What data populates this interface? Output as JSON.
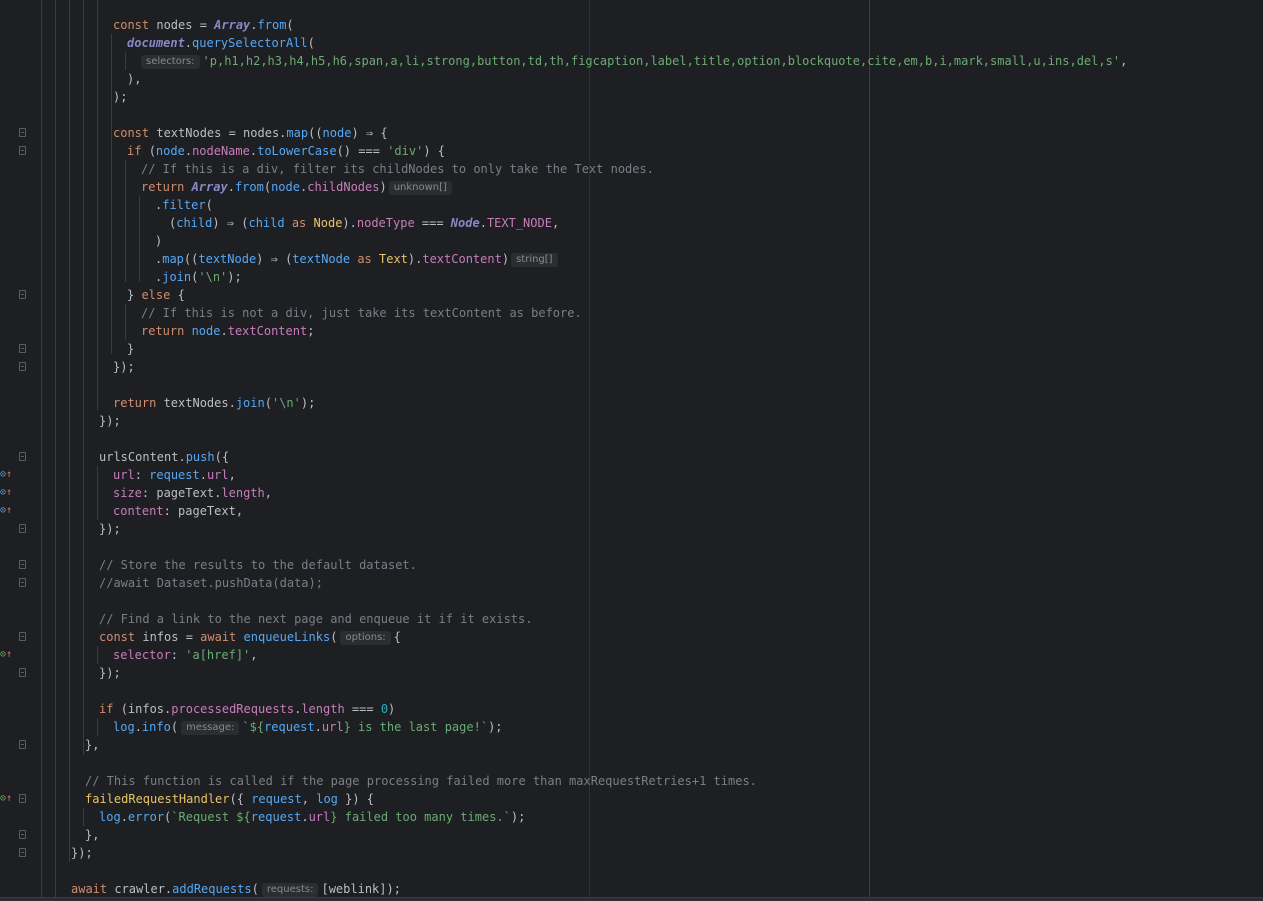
{
  "colors": {
    "background": "#1e1f22",
    "keyword": "#cf8e6d",
    "function": "#56a8f5",
    "string": "#6aab73",
    "comment": "#7a7e85",
    "property": "#c77dbb",
    "type": "#8888c6",
    "class": "#e8c46a",
    "number": "#2aacb8",
    "text": "#bcbec4",
    "hint_background": "#2b2d30",
    "hint_text": "#868a91"
  },
  "gutter_icons": {
    "fold_icon": "fold-marker",
    "override_icon": "implemented-property-icon"
  },
  "hints": {
    "selectors": "selectors:",
    "unknown_array": "unknown[]",
    "string_array": "string[]",
    "options": "options:",
    "message": "message:",
    "requests": "requests:"
  },
  "code": {
    "l01": [
      {
        "t": "const ",
        "c": "kw"
      },
      {
        "t": "nodes = ",
        "c": "var"
      },
      {
        "t": "Array",
        "c": "ty"
      },
      {
        "t": ".",
        "c": "var"
      },
      {
        "t": "from",
        "c": "fn"
      },
      {
        "t": "(",
        "c": "var"
      }
    ],
    "l02": [
      {
        "t": "document",
        "c": "ty"
      },
      {
        "t": ".",
        "c": "var"
      },
      {
        "t": "querySelectorAll",
        "c": "fn"
      },
      {
        "t": "(",
        "c": "var"
      }
    ],
    "l03_str": "'p,h1,h2,h3,h4,h5,h6,span,a,li,strong,button,td,th,figcaption,label,title,option,blockquote,cite,em,b,i,mark,small,u,ins,del,s'",
    "l03_end": ",",
    "l04": "),",
    "l05": ");",
    "l07": [
      {
        "t": "const ",
        "c": "kw"
      },
      {
        "t": "textNodes = nodes.",
        "c": "var"
      },
      {
        "t": "map",
        "c": "fn"
      },
      {
        "t": "((",
        "c": "var"
      },
      {
        "t": "node",
        "c": "param"
      },
      {
        "t": ") ⇒ {",
        "c": "var"
      }
    ],
    "l08": [
      {
        "t": "if ",
        "c": "kw"
      },
      {
        "t": "(",
        "c": "var"
      },
      {
        "t": "node",
        "c": "param"
      },
      {
        "t": ".",
        "c": "var"
      },
      {
        "t": "nodeName",
        "c": "prop"
      },
      {
        "t": ".",
        "c": "var"
      },
      {
        "t": "toLowerCase",
        "c": "fn"
      },
      {
        "t": "() ",
        "c": "var"
      },
      {
        "t": "===",
        "c": "var"
      },
      {
        "t": " ",
        "c": "var"
      },
      {
        "t": "'div'",
        "c": "str"
      },
      {
        "t": ") {",
        "c": "var"
      }
    ],
    "l09": "// If this is a div, filter its childNodes to only take the Text nodes.",
    "l10": [
      {
        "t": "return ",
        "c": "kw"
      },
      {
        "t": "Array",
        "c": "ty"
      },
      {
        "t": ".",
        "c": "var"
      },
      {
        "t": "from",
        "c": "fn"
      },
      {
        "t": "(",
        "c": "var"
      },
      {
        "t": "node",
        "c": "param"
      },
      {
        "t": ".",
        "c": "var"
      },
      {
        "t": "childNodes",
        "c": "prop"
      },
      {
        "t": ")",
        "c": "var"
      }
    ],
    "l11": [
      {
        "t": ".",
        "c": "var"
      },
      {
        "t": "filter",
        "c": "fn"
      },
      {
        "t": "(",
        "c": "var"
      }
    ],
    "l12": [
      {
        "t": "(",
        "c": "var"
      },
      {
        "t": "child",
        "c": "param"
      },
      {
        "t": ") ⇒ (",
        "c": "var"
      },
      {
        "t": "child",
        "c": "param"
      },
      {
        "t": " as ",
        "c": "kw"
      },
      {
        "t": "Node",
        "c": "cls"
      },
      {
        "t": ").",
        "c": "var"
      },
      {
        "t": "nodeType",
        "c": "prop"
      },
      {
        "t": " === ",
        "c": "var"
      },
      {
        "t": "Node",
        "c": "ty"
      },
      {
        "t": ".",
        "c": "var"
      },
      {
        "t": "TEXT_NODE",
        "c": "prop"
      },
      {
        "t": ",",
        "c": "var"
      }
    ],
    "l13": ")",
    "l14": [
      {
        "t": ".",
        "c": "var"
      },
      {
        "t": "map",
        "c": "fn"
      },
      {
        "t": "((",
        "c": "var"
      },
      {
        "t": "textNode",
        "c": "param"
      },
      {
        "t": ") ⇒ (",
        "c": "var"
      },
      {
        "t": "textNode",
        "c": "param"
      },
      {
        "t": " as ",
        "c": "kw"
      },
      {
        "t": "Text",
        "c": "cls"
      },
      {
        "t": ").",
        "c": "var"
      },
      {
        "t": "textContent",
        "c": "prop"
      },
      {
        "t": ")",
        "c": "var"
      }
    ],
    "l15": [
      {
        "t": ".",
        "c": "var"
      },
      {
        "t": "join",
        "c": "fn"
      },
      {
        "t": "(",
        "c": "var"
      },
      {
        "t": "'\\n'",
        "c": "str"
      },
      {
        "t": ");",
        "c": "var"
      }
    ],
    "l16": [
      {
        "t": "} ",
        "c": "var"
      },
      {
        "t": "else",
        "c": "kw"
      },
      {
        "t": " {",
        "c": "var"
      }
    ],
    "l17": "// If this is not a div, just take its textContent as before.",
    "l18": [
      {
        "t": "return ",
        "c": "kw"
      },
      {
        "t": "node",
        "c": "param"
      },
      {
        "t": ".",
        "c": "var"
      },
      {
        "t": "textContent",
        "c": "prop"
      },
      {
        "t": ";",
        "c": "var"
      }
    ],
    "l19": "}",
    "l20": "});",
    "l22": [
      {
        "t": "return ",
        "c": "kw"
      },
      {
        "t": "textNodes.",
        "c": "var"
      },
      {
        "t": "join",
        "c": "fn"
      },
      {
        "t": "(",
        "c": "var"
      },
      {
        "t": "'\\n'",
        "c": "str"
      },
      {
        "t": ");",
        "c": "var"
      }
    ],
    "l23": "});",
    "l25": [
      {
        "t": "urlsContent.",
        "c": "var"
      },
      {
        "t": "push",
        "c": "fn"
      },
      {
        "t": "({",
        "c": "var"
      }
    ],
    "l26": [
      {
        "t": "url",
        "c": "prop"
      },
      {
        "t": ": ",
        "c": "var"
      },
      {
        "t": "request",
        "c": "param"
      },
      {
        "t": ".",
        "c": "var"
      },
      {
        "t": "url",
        "c": "prop"
      },
      {
        "t": ",",
        "c": "var"
      }
    ],
    "l27": [
      {
        "t": "size",
        "c": "prop"
      },
      {
        "t": ": pageText.",
        "c": "var"
      },
      {
        "t": "length",
        "c": "prop"
      },
      {
        "t": ",",
        "c": "var"
      }
    ],
    "l28": [
      {
        "t": "content",
        "c": "prop"
      },
      {
        "t": ": pageText,",
        "c": "var"
      }
    ],
    "l29": "});",
    "l31": "// Store the results to the default dataset.",
    "l32": "//await Dataset.pushData(data);",
    "l34": "// Find a link to the next page and enqueue it if it exists.",
    "l35": [
      {
        "t": "const ",
        "c": "kw"
      },
      {
        "t": "infos = ",
        "c": "var"
      },
      {
        "t": "await ",
        "c": "kw"
      },
      {
        "t": "enqueueLinks",
        "c": "fn"
      },
      {
        "t": "(",
        "c": "var"
      }
    ],
    "l35_end": "{",
    "l36": [
      {
        "t": "selector",
        "c": "prop"
      },
      {
        "t": ": ",
        "c": "var"
      },
      {
        "t": "'a[href]'",
        "c": "str"
      },
      {
        "t": ",",
        "c": "var"
      }
    ],
    "l37": "});",
    "l39": [
      {
        "t": "if ",
        "c": "kw"
      },
      {
        "t": "(infos.",
        "c": "var"
      },
      {
        "t": "processedRequests",
        "c": "prop"
      },
      {
        "t": ".",
        "c": "var"
      },
      {
        "t": "length",
        "c": "prop"
      },
      {
        "t": " === ",
        "c": "var"
      },
      {
        "t": "0",
        "c": "num"
      },
      {
        "t": ")",
        "c": "var"
      }
    ],
    "l40": [
      {
        "t": "log",
        "c": "param"
      },
      {
        "t": ".",
        "c": "var"
      },
      {
        "t": "info",
        "c": "fn"
      },
      {
        "t": "(",
        "c": "var"
      }
    ],
    "l40_end": [
      {
        "t": "`${",
        "c": "str"
      },
      {
        "t": "request",
        "c": "param"
      },
      {
        "t": ".",
        "c": "var"
      },
      {
        "t": "url",
        "c": "prop"
      },
      {
        "t": "} is the last page!`",
        "c": "str"
      },
      {
        "t": ");",
        "c": "var"
      }
    ],
    "l41": "},",
    "l43": "// This function is called if the page processing failed more than maxRequestRetries+1 times.",
    "l44": [
      {
        "t": "failedRequestHandler",
        "c": "cls"
      },
      {
        "t": "({ ",
        "c": "var"
      },
      {
        "t": "request",
        "c": "param"
      },
      {
        "t": ", ",
        "c": "var"
      },
      {
        "t": "log",
        "c": "param"
      },
      {
        "t": " }) {",
        "c": "var"
      }
    ],
    "l45": [
      {
        "t": "log",
        "c": "param"
      },
      {
        "t": ".",
        "c": "var"
      },
      {
        "t": "error",
        "c": "fn"
      },
      {
        "t": "(",
        "c": "var"
      },
      {
        "t": "`Request ${",
        "c": "str"
      },
      {
        "t": "request",
        "c": "param"
      },
      {
        "t": ".",
        "c": "var"
      },
      {
        "t": "url",
        "c": "prop"
      },
      {
        "t": "} failed too many times.`",
        "c": "str"
      },
      {
        "t": ");",
        "c": "var"
      }
    ],
    "l46": "},",
    "l47": "});",
    "l49": [
      {
        "t": "await ",
        "c": "kw"
      },
      {
        "t": "crawler.",
        "c": "var"
      },
      {
        "t": "addRequests",
        "c": "fn"
      },
      {
        "t": "(",
        "c": "var"
      }
    ],
    "l49_end": "[weblink]);"
  }
}
